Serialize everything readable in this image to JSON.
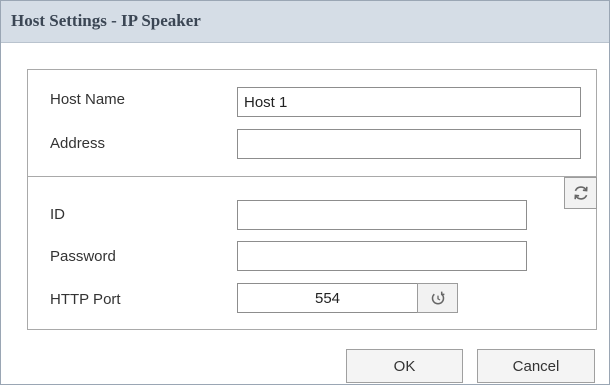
{
  "dialog": {
    "title": "Host Settings - IP Speaker"
  },
  "fields": {
    "host_name": {
      "label": "Host Name",
      "value": "Host 1"
    },
    "address": {
      "label": "Address",
      "value": ""
    },
    "id": {
      "label": "ID",
      "value": ""
    },
    "password": {
      "label": "Password",
      "value": ""
    },
    "http_port": {
      "label": "HTTP Port",
      "value": "554"
    }
  },
  "icons": {
    "refresh": "refresh-icon",
    "reset_port": "reset-port-icon"
  },
  "buttons": {
    "ok": "OK",
    "cancel": "Cancel"
  },
  "colors": {
    "titlebar_bg": "#d5dde6",
    "title_text": "#3b4654",
    "icon_stroke": "#666666"
  }
}
